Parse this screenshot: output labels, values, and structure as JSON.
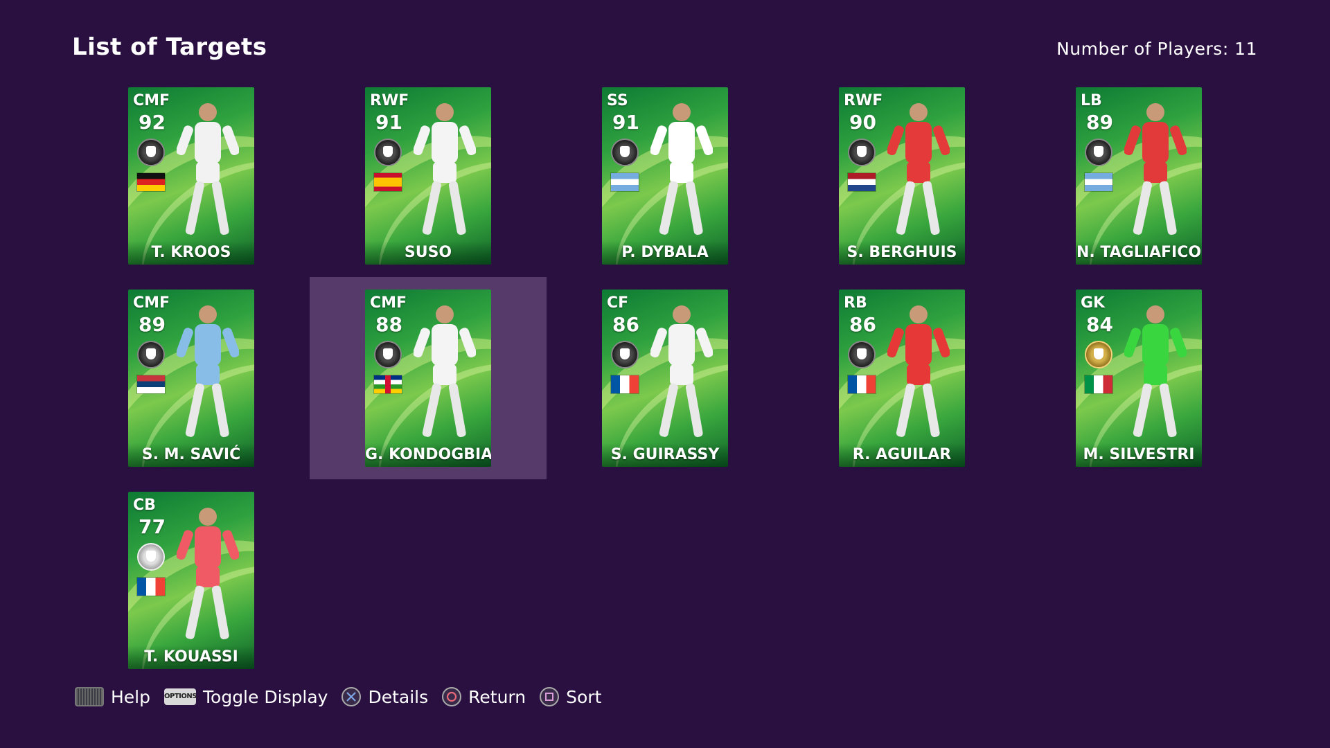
{
  "header": {
    "title": "List of Targets",
    "player_count": "Number of Players: 11"
  },
  "cards": [
    {
      "pos": "CMF",
      "ovr": "92",
      "name": "T. KROOS",
      "badge": "dark",
      "flag": "germany",
      "kit": "#f2f2f2"
    },
    {
      "pos": "RWF",
      "ovr": "91",
      "name": "SUSO",
      "badge": "dark",
      "flag": "spain",
      "kit": "#f4f4f4"
    },
    {
      "pos": "SS",
      "ovr": "91",
      "name": "P. DYBALA",
      "badge": "dark",
      "flag": "argentina",
      "kit": "#ffffff"
    },
    {
      "pos": "RWF",
      "ovr": "90",
      "name": "S. BERGHUIS",
      "badge": "dark",
      "flag": "netherlands",
      "kit": "#e53a3a"
    },
    {
      "pos": "LB",
      "ovr": "89",
      "name": "N. TAGLIAFICO",
      "badge": "dark",
      "flag": "argentina",
      "kit": "#e23a3a"
    },
    {
      "pos": "CMF",
      "ovr": "89",
      "name": "S. M. SAVIĆ",
      "badge": "dark",
      "flag": "serbia",
      "kit": "#87bde6"
    },
    {
      "pos": "CMF",
      "ovr": "88",
      "name": "G. KONDOGBIA",
      "badge": "dark",
      "flag": "central-african-republic",
      "kit": "#f4f4f4"
    },
    {
      "pos": "CF",
      "ovr": "86",
      "name": "S. GUIRASSY",
      "badge": "dark",
      "flag": "france",
      "kit": "#f4f4f4"
    },
    {
      "pos": "RB",
      "ovr": "86",
      "name": "R. AGUILAR",
      "badge": "dark",
      "flag": "france",
      "kit": "#e73838"
    },
    {
      "pos": "GK",
      "ovr": "84",
      "name": "M. SILVESTRI",
      "badge": "gold",
      "flag": "italy",
      "kit": "#3ad640"
    },
    {
      "pos": "CB",
      "ovr": "77",
      "name": "T. KOUASSI",
      "badge": "silver",
      "flag": "france",
      "kit": "#f05a64"
    }
  ],
  "footer": {
    "help": "Help",
    "options_key": "OPTIONS",
    "toggle_display": "Toggle Display",
    "details": "Details",
    "return": "Return",
    "sort": "Sort"
  },
  "colors": {
    "background": "#2a1040",
    "highlight": "#553a6a"
  }
}
